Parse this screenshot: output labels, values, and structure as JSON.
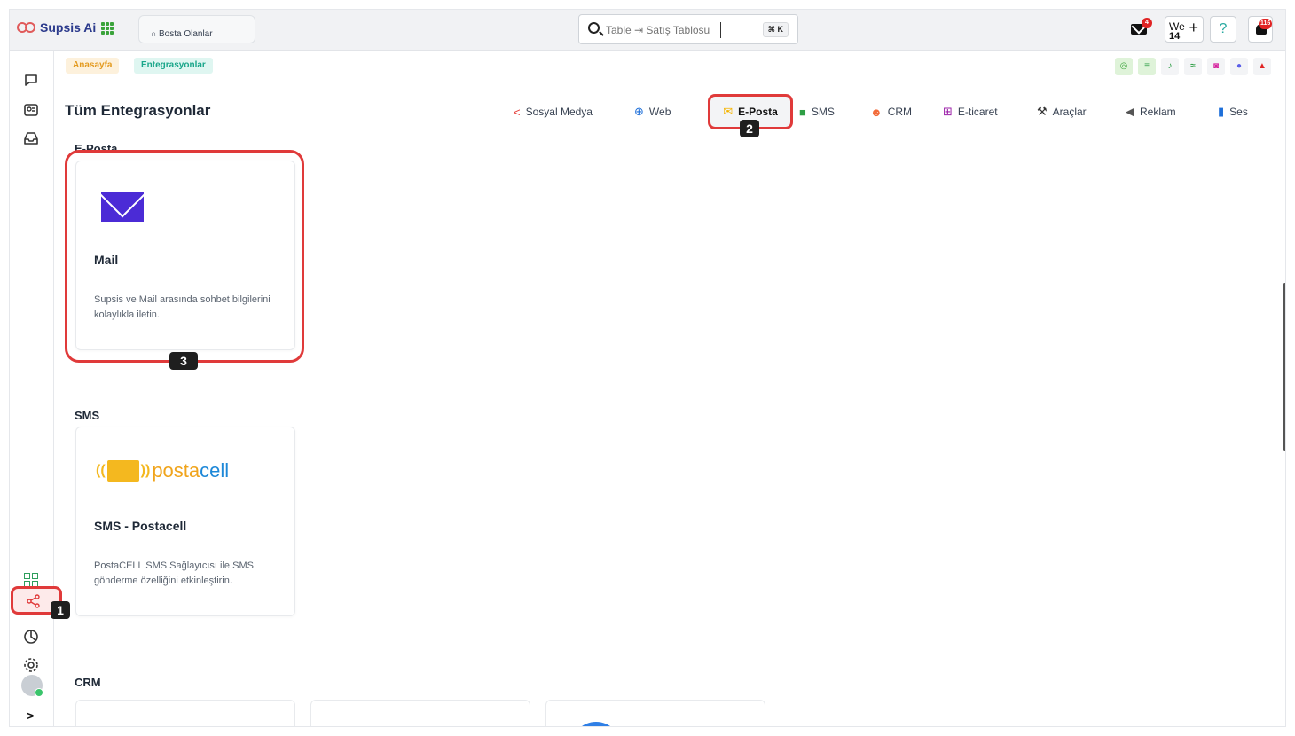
{
  "app": {
    "name": "Supsis Ai"
  },
  "header": {
    "tab_label": "Bosta Olanlar",
    "search_placeholder": "Table ⇥ Satış Tablosu",
    "search_shortcut": "⌘ K",
    "mail_badge": "4",
    "workspace_short": "We",
    "workspace_number": "14",
    "workspace_add": "+",
    "help": "?",
    "notifications_badge": "116"
  },
  "breadcrumb": {
    "home": "Anasayfa",
    "current": "Entegrasyonlar"
  },
  "page": {
    "title": "Tüm Entegrasyonlar"
  },
  "categories": [
    {
      "label": "Sosyal Medya",
      "icon": "share-icon",
      "color": "#e53935"
    },
    {
      "label": "Web",
      "icon": "globe-icon",
      "color": "#1e6fd9"
    },
    {
      "label": "E-Posta",
      "icon": "email-icon",
      "color": "#f4b400"
    },
    {
      "label": "SMS",
      "icon": "sms-icon",
      "color": "#2e9e45"
    },
    {
      "label": "CRM",
      "icon": "people-icon",
      "color": "#f26b3a"
    },
    {
      "label": "E-ticaret",
      "icon": "cart-icon",
      "color": "#9b1fa8"
    },
    {
      "label": "Araçlar",
      "icon": "wrench-icon",
      "color": "#333333"
    },
    {
      "label": "Reklam",
      "icon": "megaphone-icon",
      "color": "#555555"
    },
    {
      "label": "Ses",
      "icon": "mic-icon",
      "color": "#1e6fd9"
    }
  ],
  "sections": [
    {
      "title": "E-Posta",
      "cards": [
        {
          "title": "Mail",
          "description": "Supsis ve Mail arasında sohbet bilgilerini kolaylıkla iletin."
        }
      ]
    },
    {
      "title": "SMS",
      "cards": [
        {
          "title": "SMS - Postacell",
          "description": "PostaCELL SMS Sağlayıcısı ile SMS gönderme özelliğini etkinleştirin.",
          "logo_text_a": "posta",
          "logo_text_b": "cell"
        }
      ]
    },
    {
      "title": "CRM"
    }
  ],
  "markers": [
    "1",
    "2",
    "3"
  ],
  "colors": {
    "highlight": "#e03a3a",
    "mail_brand": "#4b2bd6",
    "accent_orange": "#e39a1f",
    "accent_teal": "#1aa68a"
  }
}
